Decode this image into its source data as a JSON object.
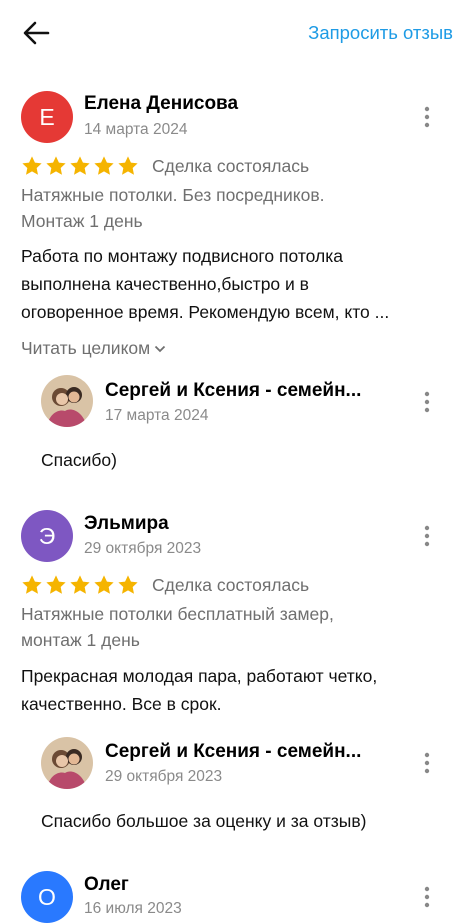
{
  "header": {
    "request_review_label": "Запросить отзыв"
  },
  "colors": {
    "accent": "#1e9be5",
    "star": "#f5b400",
    "avatar_e": "#e53935",
    "avatar_uh": "#7e57c2",
    "avatar_o": "#2979ff"
  },
  "reviews": [
    {
      "initial": "Е",
      "name": "Елена Денисова",
      "date": "14 марта 2024",
      "rating": 5,
      "deal": "Сделка состоялась",
      "category_line1": "Натяжные потолки. Без посредников.",
      "category_line2": "Монтаж 1 день",
      "text_line1": "Работа по монтажу подвисного потолка",
      "text_line2": "выполнена качественно,быстро и в",
      "text_line3": "оговоренное время. Рекомендую всем, кто ...",
      "read_more": "Читать целиком",
      "reply": {
        "name": "Сергей и Ксения - семейн...",
        "date": "17 марта 2024",
        "text": "Спасибо)"
      }
    },
    {
      "initial": "Э",
      "name": "Эльмира",
      "date": "29 октября 2023",
      "rating": 5,
      "deal": "Сделка состоялась",
      "category_line1": "Натяжные потолки бесплатный замер,",
      "category_line2": "монтаж 1 день",
      "text_line1": "Прекрасная молодая пара, работают четко,",
      "text_line2": "качественно. Все в срок.",
      "reply": {
        "name": "Сергей и Ксения - семейн...",
        "date": "29 октября 2023",
        "text": "Спасибо большое за оценку и за отзыв)"
      }
    },
    {
      "initial": "О",
      "name": "Олег",
      "date": "16 июля 2023"
    }
  ]
}
